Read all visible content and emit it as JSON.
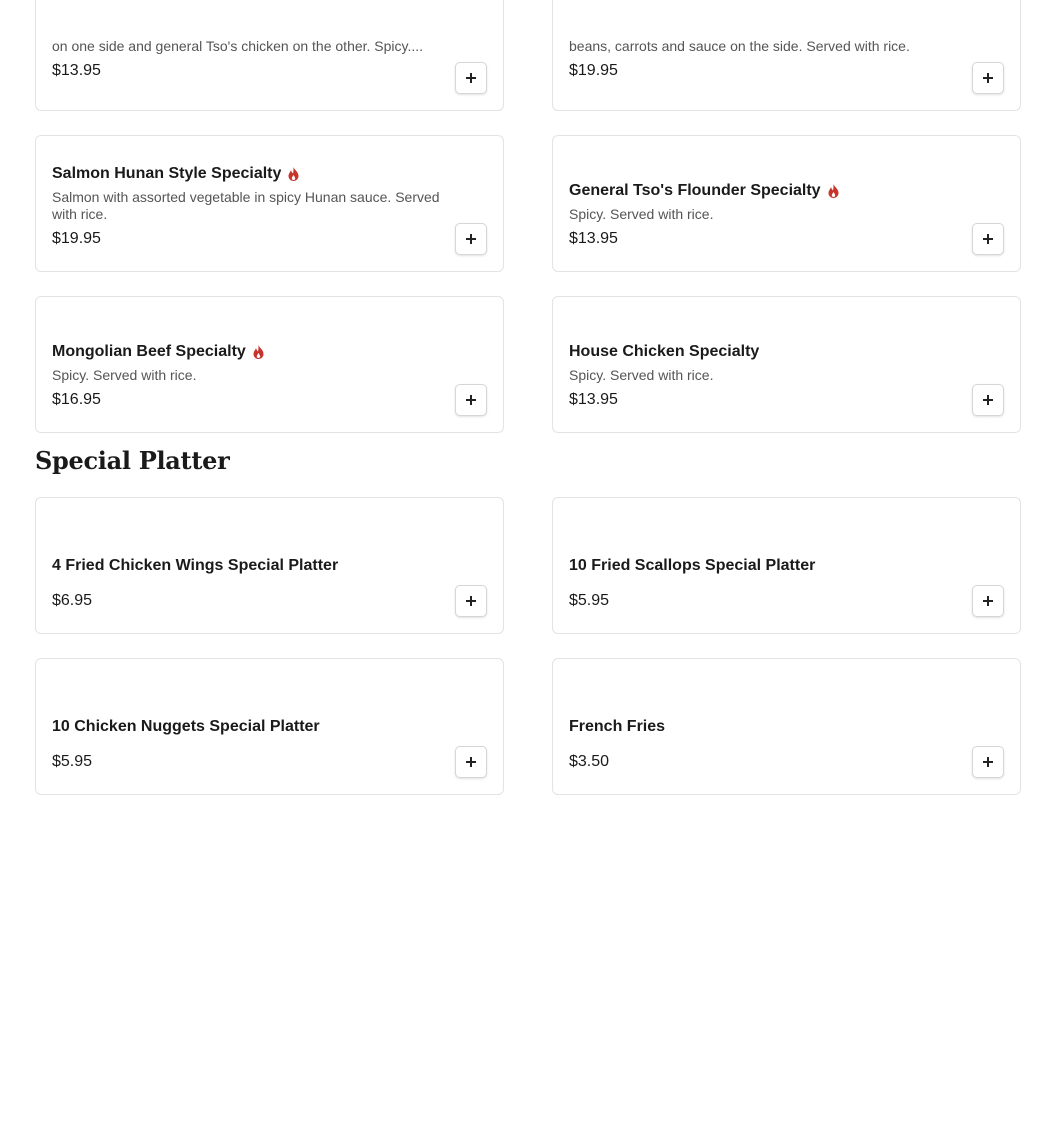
{
  "colors": {
    "spicy_icon": "#c8332b",
    "border": "#e3e3e3"
  },
  "top_items": [
    {
      "name": "",
      "description": "on one side and general Tso's chicken on the other. Spicy....",
      "price": "$13.95",
      "spicy": false
    },
    {
      "name": "",
      "description": "beans, carrots and sauce on the side. Served with rice.",
      "price": "$19.95",
      "spicy": false
    },
    {
      "name": "Salmon Hunan Style Specialty",
      "description": "Salmon with assorted vegetable in spicy Hunan sauce. Served with rice.",
      "price": "$19.95",
      "spicy": true
    },
    {
      "name": "General Tso's Flounder Specialty",
      "description": "Spicy. Served with rice.",
      "price": "$13.95",
      "spicy": true
    },
    {
      "name": "Mongolian Beef Specialty",
      "description": "Spicy. Served with rice.",
      "price": "$16.95",
      "spicy": true
    },
    {
      "name": "House Chicken Specialty",
      "description": "Spicy. Served with rice.",
      "price": "$13.95",
      "spicy": false
    }
  ],
  "special_platter": {
    "title": "Special Platter",
    "items": [
      {
        "name": "4 Fried Chicken Wings Special Platter",
        "price": "$6.95"
      },
      {
        "name": "10 Fried Scallops Special Platter",
        "price": "$5.95"
      },
      {
        "name": "10 Chicken Nuggets Special Platter",
        "price": "$5.95"
      },
      {
        "name": "French Fries",
        "price": "$3.50"
      }
    ]
  }
}
